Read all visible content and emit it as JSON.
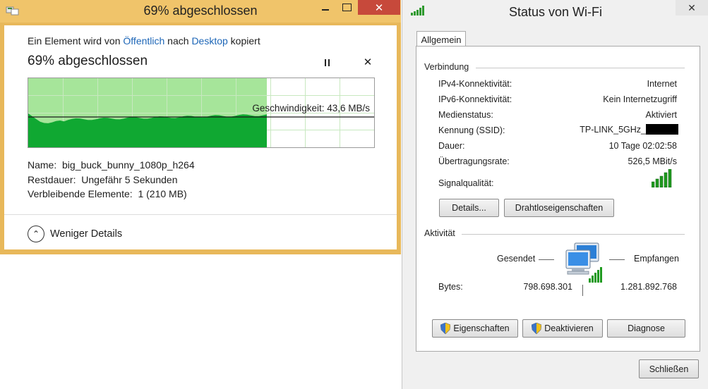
{
  "copy_dialog": {
    "window_title": "69% abgeschlossen",
    "description_prefix": "Ein Element wird von ",
    "source": "Öffentlich",
    "middle": " nach ",
    "destination": "Desktop",
    "description_suffix": " kopiert",
    "heading": "69% abgeschlossen",
    "progress_fraction": 0.69,
    "speed_text": "Geschwindigkeit: 43,6 MB/s",
    "name_line": "Name:  big_buck_bunny_1080p_h264",
    "remaining_time_line": "Restdauer:  Ungefähr 5 Sekunden",
    "remaining_items_line": "Verbleibende Elemente:  1 (210 MB)",
    "fewer_details_label": "Weniger Details"
  },
  "wifi_dialog": {
    "window_title": "Status von Wi-Fi",
    "tab_label": "Allgemein",
    "connection_group": "Verbindung",
    "rows": [
      {
        "label": "IPv4-Konnektivität:",
        "value": "Internet"
      },
      {
        "label": "IPv6-Konnektivität:",
        "value": "Kein Internetzugriff"
      },
      {
        "label": "Medienstatus:",
        "value": "Aktiviert"
      },
      {
        "label": "Kennung (SSID):",
        "value": "TP-LINK_5GHz_"
      },
      {
        "label": "Dauer:",
        "value": "10 Tage 02:02:58"
      },
      {
        "label": "Übertragungsrate:",
        "value": "526,5 MBit/s"
      }
    ],
    "signal_label": "Signalqualität:",
    "details_button": "Details...",
    "wireless_props_button": "Drahtloseigenschaften",
    "activity_group": "Aktivität",
    "sent_label": "Gesendet",
    "received_label": "Empfangen",
    "bytes_label": "Bytes:",
    "bytes_sent": "798.698.301",
    "bytes_received": "1.281.892.768",
    "properties_button": "Eigenschaften",
    "deactivate_button": "Deaktivieren",
    "diagnose_button": "Diagnose",
    "close_button": "Schließen"
  },
  "colors": {
    "copy_frame": "#e8b85a",
    "graph_fill": "#10a832",
    "graph_bg": "#a6e59a",
    "link": "#1d66b7"
  }
}
